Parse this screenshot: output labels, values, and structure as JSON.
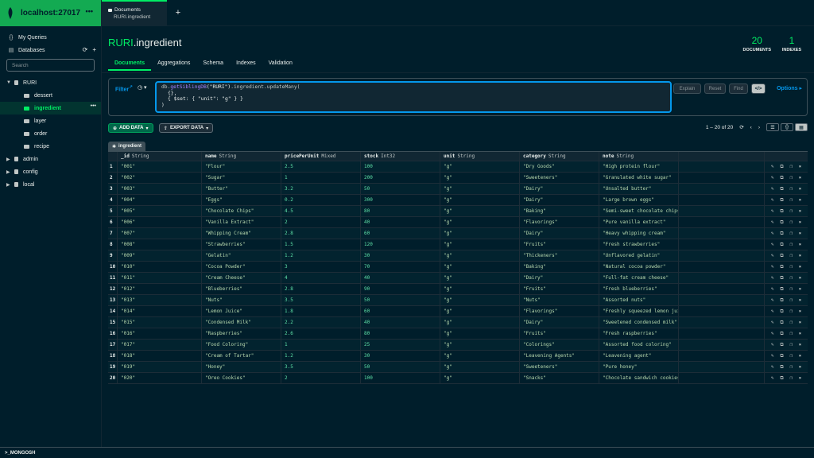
{
  "sidebar": {
    "connection": "localhost:27017",
    "my_queries": "My Queries",
    "databases": "Databases",
    "search_placeholder": "Search",
    "db_ruri": "RURI",
    "collections": [
      "dessert",
      "ingredient",
      "layer",
      "order",
      "recipe"
    ],
    "db_admin": "admin",
    "db_config": "config",
    "db_local": "local"
  },
  "tab": {
    "title": "Documents",
    "subtitle": "RURI.ingredient"
  },
  "header": {
    "db": "RURI",
    "collection": ".ingredient",
    "documents_count": "20",
    "documents_label": "DOCUMENTS",
    "indexes_count": "1",
    "indexes_label": "INDEXES"
  },
  "subtabs": [
    "Documents",
    "Aggregations",
    "Schema",
    "Indexes",
    "Validation"
  ],
  "query": {
    "filter_label": "Filter",
    "line1_db": "db.",
    "line1_fn": "getSiblingDB",
    "line1_arg": "(\"RURI\")",
    "line1_rest": ".ingredient.updateMany(",
    "line2": "{},",
    "line3": "{ $set: { \"unit\": \"g\" } }",
    "line4": ")",
    "explain": "Explain",
    "reset": "Reset",
    "find": "Find",
    "options": "Options ▸"
  },
  "actions": {
    "add_data": "ADD DATA",
    "export_data": "EXPORT DATA",
    "pager": "1 – 20 of 20"
  },
  "table": {
    "collection_label": "ingredient",
    "columns": [
      {
        "name": "_id",
        "type": "String"
      },
      {
        "name": "name",
        "type": "String"
      },
      {
        "name": "pricePerUnit",
        "type": "Mixed"
      },
      {
        "name": "stock",
        "type": "Int32"
      },
      {
        "name": "unit",
        "type": "String"
      },
      {
        "name": "category",
        "type": "String"
      },
      {
        "name": "note",
        "type": "String"
      }
    ],
    "rows": [
      [
        "1",
        "\"001\"",
        "\"Flour\"",
        "2.5",
        "100",
        "\"g\"",
        "\"Dry Goods\"",
        "\"High protein flour\""
      ],
      [
        "2",
        "\"002\"",
        "\"Sugar\"",
        "1",
        "200",
        "\"g\"",
        "\"Sweeteners\"",
        "\"Granulated white sugar\""
      ],
      [
        "3",
        "\"003\"",
        "\"Butter\"",
        "3.2",
        "50",
        "\"g\"",
        "\"Dairy\"",
        "\"Unsalted butter\""
      ],
      [
        "4",
        "\"004\"",
        "\"Eggs\"",
        "0.2",
        "300",
        "\"g\"",
        "\"Dairy\"",
        "\"Large brown eggs\""
      ],
      [
        "5",
        "\"005\"",
        "\"Chocolate Chips\"",
        "4.5",
        "80",
        "\"g\"",
        "\"Baking\"",
        "\"Semi-sweet chocolate chips\""
      ],
      [
        "6",
        "\"006\"",
        "\"Vanilla Extract\"",
        "2",
        "40",
        "\"g\"",
        "\"Flavorings\"",
        "\"Pure vanilla extract\""
      ],
      [
        "7",
        "\"007\"",
        "\"Whipping Cream\"",
        "2.8",
        "60",
        "\"g\"",
        "\"Dairy\"",
        "\"Heavy whipping cream\""
      ],
      [
        "8",
        "\"008\"",
        "\"Strawberries\"",
        "1.5",
        "120",
        "\"g\"",
        "\"Fruits\"",
        "\"Fresh strawberries\""
      ],
      [
        "9",
        "\"009\"",
        "\"Gelatin\"",
        "1.2",
        "30",
        "\"g\"",
        "\"Thickeners\"",
        "\"Unflavored gelatin\""
      ],
      [
        "10",
        "\"010\"",
        "\"Cocoa Powder\"",
        "3",
        "70",
        "\"g\"",
        "\"Baking\"",
        "\"Natural cocoa powder\""
      ],
      [
        "11",
        "\"011\"",
        "\"Cream Cheese\"",
        "4",
        "40",
        "\"g\"",
        "\"Dairy\"",
        "\"Full-fat cream cheese\""
      ],
      [
        "12",
        "\"012\"",
        "\"Blueberries\"",
        "2.8",
        "90",
        "\"g\"",
        "\"Fruits\"",
        "\"Fresh blueberries\""
      ],
      [
        "13",
        "\"013\"",
        "\"Nuts\"",
        "3.5",
        "50",
        "\"g\"",
        "\"Nuts\"",
        "\"Assorted nuts\""
      ],
      [
        "14",
        "\"014\"",
        "\"Lemon Juice\"",
        "1.8",
        "60",
        "\"g\"",
        "\"Flavorings\"",
        "\"Freshly squeezed lemon jui…"
      ],
      [
        "15",
        "\"015\"",
        "\"Condensed Milk\"",
        "2.2",
        "40",
        "\"g\"",
        "\"Dairy\"",
        "\"Sweetened condensed milk\""
      ],
      [
        "16",
        "\"016\"",
        "\"Raspberries\"",
        "2.6",
        "80",
        "\"g\"",
        "\"Fruits\"",
        "\"Fresh raspberries\""
      ],
      [
        "17",
        "\"017\"",
        "\"Food Coloring\"",
        "1",
        "25",
        "\"g\"",
        "\"Colorings\"",
        "\"Assorted food coloring\""
      ],
      [
        "18",
        "\"018\"",
        "\"Cream of Tartar\"",
        "1.2",
        "30",
        "\"g\"",
        "\"Leavening Agents\"",
        "\"Leavening agent\""
      ],
      [
        "19",
        "\"019\"",
        "\"Honey\"",
        "3.5",
        "50",
        "\"g\"",
        "\"Sweeteners\"",
        "\"Pure honey\""
      ],
      [
        "20",
        "\"020\"",
        "\"Oreo Cookies\"",
        "2",
        "100",
        "\"g\"",
        "\"Snacks\"",
        "\"Chocolate sandwich cookies\""
      ]
    ]
  },
  "footer": {
    "label": ">_MONGOSH"
  },
  "colors": {
    "accent": "#00ed64",
    "brand": "#13aa52",
    "link": "#0498ec",
    "bg": "#001e2b"
  }
}
